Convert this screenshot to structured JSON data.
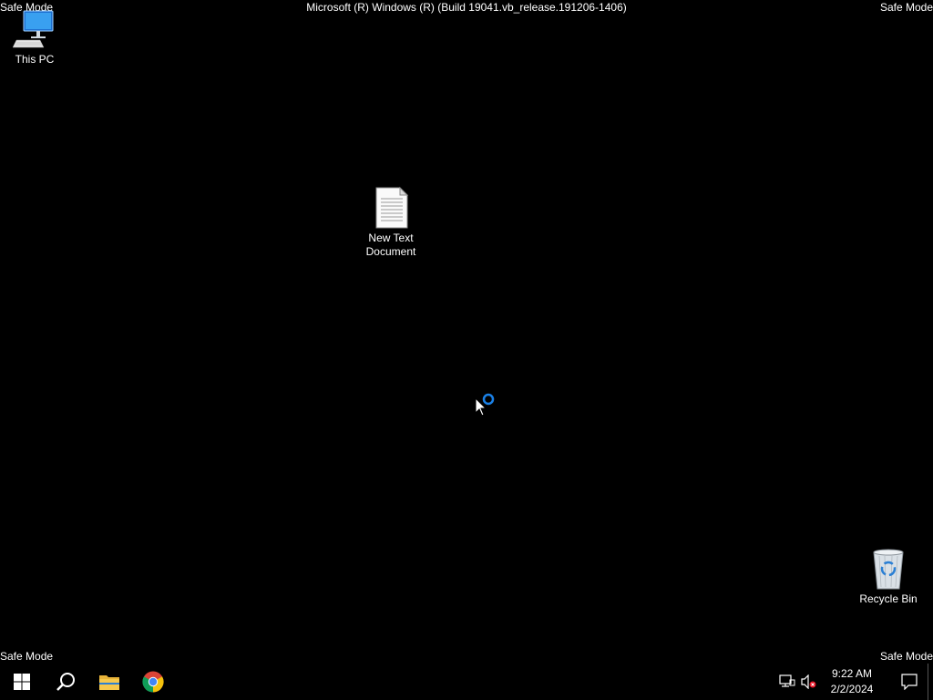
{
  "desktop": {
    "background_color": "#000000",
    "safe_mode_labels": {
      "top_left": "Safe Mode",
      "top_right": "Safe Mode",
      "bottom_left": "Safe Mode",
      "bottom_right": "Safe Mode"
    },
    "build_text": "Microsoft (R) Windows (R) (Build 19041.vb_release.191206-1406)",
    "icons": [
      {
        "label": "This PC",
        "icon": "computer-icon"
      },
      {
        "label": "New Text\nDocument",
        "icon": "text-document-icon"
      },
      {
        "label": "Recycle Bin",
        "icon": "recycle-bin-icon"
      }
    ],
    "cursor": "busy-cursor"
  },
  "taskbar": {
    "buttons": [
      {
        "name": "start",
        "icon": "windows-logo-icon"
      },
      {
        "name": "search",
        "icon": "search-icon"
      },
      {
        "name": "file-explorer",
        "icon": "folder-icon"
      },
      {
        "name": "chrome",
        "icon": "chrome-icon"
      }
    ],
    "tray": {
      "network_icon": "network-icon",
      "volume_icon": "volume-muted-icon",
      "time": "9:22 AM",
      "date": "2/2/2024",
      "notification_icon": "action-center-icon"
    }
  }
}
